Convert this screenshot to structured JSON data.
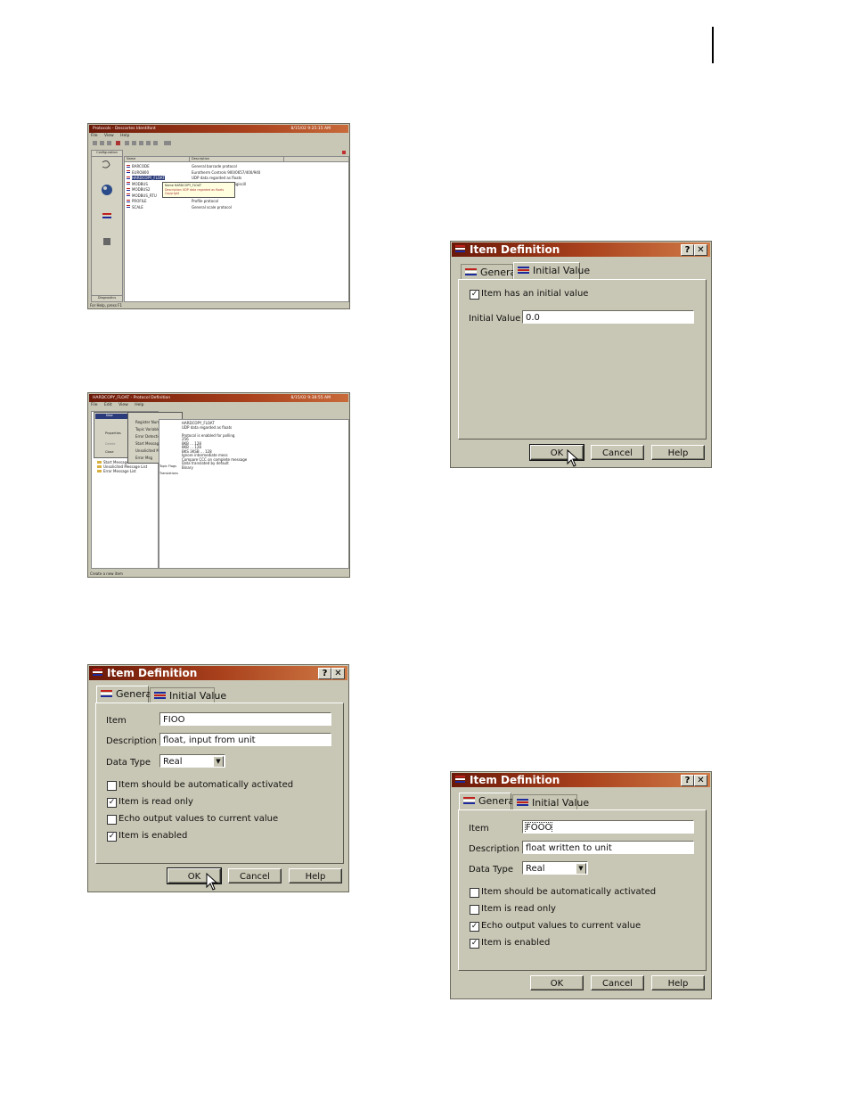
{
  "colors": {
    "dialog_face": "#c8c6b4",
    "titlebar_dark": "#6a1808",
    "titlebar_light": "#d07a46",
    "icon_red": "#c0201c",
    "icon_blue": "#1c2a9c"
  },
  "shot1": {
    "title": "Protocols - Descartes Identifont",
    "time": "8/15/02 9:25:15 AM",
    "menu": [
      "File",
      "View",
      "Help"
    ],
    "side_top": "Configuration",
    "side_bottom": "Diagnostics",
    "columns": [
      "Name",
      "Description"
    ],
    "rows": [
      {
        "name": "BARCODE",
        "desc": "General barcode protocol"
      },
      {
        "name": "EURO800",
        "desc": "Eurotherm Controls 900/0657/400/940"
      },
      {
        "name": "HARDCOPY_FLOAT",
        "desc": "UDP data regarded as floats"
      },
      {
        "name": "MODBUS",
        "desc": "Modbus/Modbus/ASCII/Digiscill"
      },
      {
        "name": "MODBUS2",
        "desc": "Modbus 2 protocol"
      },
      {
        "name": "MODBUS_RTU",
        "desc": "Modbus RTU protocol"
      },
      {
        "name": "PROFILE",
        "desc": "Profile protocol"
      },
      {
        "name": "SCALE",
        "desc": "General scale protocol"
      }
    ],
    "tooltip": [
      "Name   HARDCOPY_FLOAT",
      "Description   UDP data regarded as floats",
      "Copyright"
    ],
    "status": "For Help, press F1"
  },
  "shot2": {
    "title": "HARDCOPY_FLOAT - Protocol Definition",
    "time": "8/15/02 9:38:55 AM",
    "menu": [
      "File",
      "Edit",
      "View",
      "Help"
    ],
    "menu_open": "New",
    "submenu": [
      "Register Number",
      "Topic Variable",
      "Error Detection Code",
      "Start Message",
      "Unsolicited Msg",
      "Error Msg"
    ],
    "left_menu": [
      "Properties",
      "Delete",
      "Close"
    ],
    "tree": [
      "Start Messages",
      "Unsolicited Message List",
      "Error Message List"
    ],
    "props": [
      "HARDCOPY_FLOAT",
      "UDP data regarded as floats",
      "",
      "Protocol is enabled for polling",
      "256",
      "8KB ... 128",
      "8KB ... 128",
      "BKS 3KSB ... 128",
      "Ignore intermediate mess",
      "Compare CCC on complete message",
      "Data translated by default",
      "Binary"
    ],
    "prop_labels": [
      "Topic Flags",
      "Translations"
    ],
    "status": "Create a new item"
  },
  "dialog_general": {
    "title": "Item Definition",
    "help_btn": "?",
    "close_btn": "✕",
    "tabs": [
      "General",
      "Initial Value"
    ],
    "item_label": "Item",
    "item_value": "FIOO",
    "desc_label": "Description",
    "desc_value": "float, input from unit",
    "type_label": "Data Type",
    "type_value": "Real",
    "checks": [
      {
        "label": "Item should be automatically activated",
        "checked": false
      },
      {
        "label": "Item is read only",
        "checked": true
      },
      {
        "label": "Echo output values to current value",
        "checked": false
      },
      {
        "label": "Item is enabled",
        "checked": true
      }
    ],
    "ok": "OK",
    "cancel": "Cancel",
    "help": "Help"
  },
  "dialog_initial": {
    "title": "Item Definition",
    "help_btn": "?",
    "close_btn": "✕",
    "tabs": [
      "General",
      "Initial Value"
    ],
    "check_label": "Item has an initial value",
    "check_checked": true,
    "iv_label": "Initial Value",
    "iv_value": "0.0",
    "ok": "OK",
    "cancel": "Cancel",
    "help": "Help"
  },
  "dialog_general2": {
    "title": "Item Definition",
    "help_btn": "?",
    "close_btn": "✕",
    "tabs": [
      "General",
      "Initial Value"
    ],
    "item_label": "Item",
    "item_value": "FOOO",
    "desc_label": "Description",
    "desc_value": "float written to unit",
    "type_label": "Data Type",
    "type_value": "Real",
    "checks": [
      {
        "label": "Item should be automatically activated",
        "checked": false
      },
      {
        "label": "Item is read only",
        "checked": false
      },
      {
        "label": "Echo output values to current value",
        "checked": true
      },
      {
        "label": "Item is enabled",
        "checked": true
      }
    ],
    "ok": "OK",
    "cancel": "Cancel",
    "help": "Help"
  }
}
